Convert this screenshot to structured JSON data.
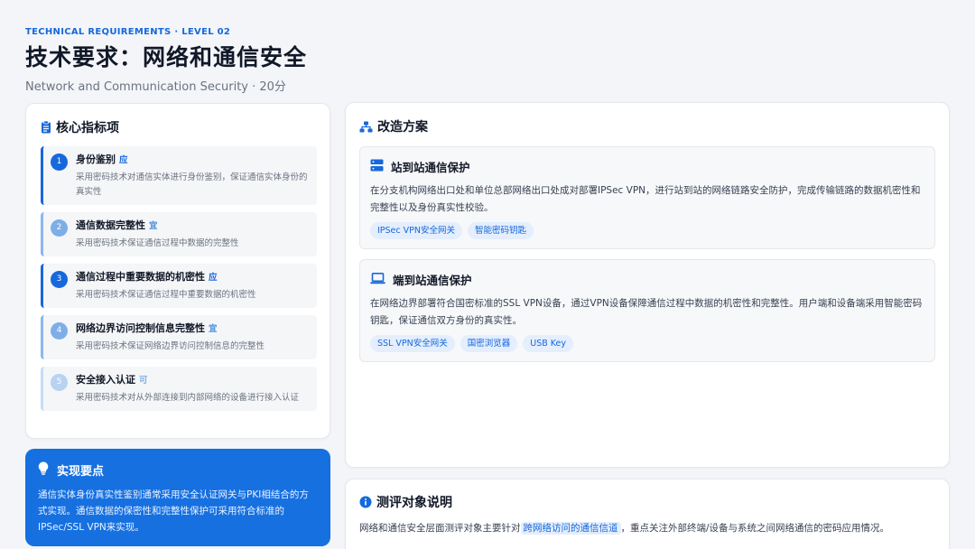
{
  "header": {
    "eyebrow": "TECHNICAL REQUIREMENTS · LEVEL 02",
    "title": "技术要求：网络和通信安全",
    "subtitle": "Network and Communication Security · 20分"
  },
  "indicators": {
    "title": "核心指标项",
    "items": [
      {
        "num": "1",
        "name": "身份鉴别",
        "tag": "应",
        "desc": "采用密码技术对通信实体进行身份鉴别，保证通信实体身份的真实性"
      },
      {
        "num": "2",
        "name": "通信数据完整性",
        "tag": "宜",
        "desc": "采用密码技术保证通信过程中数据的完整性"
      },
      {
        "num": "3",
        "name": "通信过程中重要数据的机密性",
        "tag": "应",
        "desc": "采用密码技术保证通信过程中重要数据的机密性"
      },
      {
        "num": "4",
        "name": "网络边界访问控制信息完整性",
        "tag": "宜",
        "desc": "采用密码技术保证网络边界访问控制信息的完整性"
      },
      {
        "num": "5",
        "name": "安全接入认证",
        "tag": "可",
        "desc": "采用密码技术对从外部连接到内部网络的设备进行接入认证"
      }
    ]
  },
  "tip": {
    "title": "实现要点",
    "text": "通信实体身份真实性鉴别通常采用安全认证网关与PKI相结合的方式实现。通信数据的保密性和完整性保护可采用符合标准的IPSec/SSL VPN来实现。"
  },
  "plans": {
    "title": "改造方案",
    "items": [
      {
        "title": "站到站通信保护",
        "icon": "server-icon",
        "desc": "在分支机构网络出口处和单位总部网络出口处成对部署IPSec VPN，进行站到站的网络链路安全防护，完成传输链路的数据机密性和完整性以及身份真实性校验。",
        "chips": [
          "IPSec VPN安全网关",
          "智能密码钥匙"
        ]
      },
      {
        "title": "端到站通信保护",
        "icon": "laptop-icon",
        "desc": "在网络边界部署符合国密标准的SSL VPN设备，通过VPN设备保障通信过程中数据的机密性和完整性。用户端和设备端采用智能密码钥匙，保证通信双方身份的真实性。",
        "chips": [
          "SSL VPN安全网关",
          "国密浏览器",
          "USB Key"
        ]
      }
    ]
  },
  "object": {
    "title": "测评对象说明",
    "text_before": "网络和通信安全层面测评对象主要针对",
    "highlight": "跨网络访问的通信信道",
    "text_after": "，重点关注外部终端/设备与系统之间网络通信的密码应用情况。"
  },
  "colors": {
    "accent": "#1668dc",
    "tip_bg": "#1670e0",
    "chip_bg": "#e4eefc"
  }
}
